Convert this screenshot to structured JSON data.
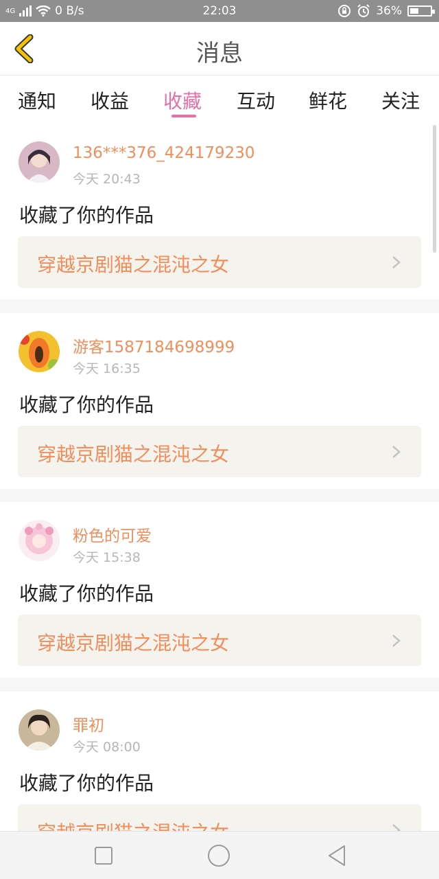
{
  "status_bar": {
    "network": "4G",
    "speed": "0 B/s",
    "time": "22:03",
    "battery": "36%"
  },
  "header": {
    "title": "消息"
  },
  "tabs": [
    {
      "label": "通知"
    },
    {
      "label": "收益"
    },
    {
      "label": "收藏"
    },
    {
      "label": "互动"
    },
    {
      "label": "鲜花"
    },
    {
      "label": "关注"
    }
  ],
  "active_tab_index": 2,
  "messages": [
    {
      "user": "136***376_424179230",
      "time": "今天 20:43",
      "action": "收藏了你的作品",
      "work": "穿越京剧猫之混沌之女"
    },
    {
      "user": "游客1587184698999",
      "time": "今天 16:35",
      "action": "收藏了你的作品",
      "work": "穿越京剧猫之混沌之女"
    },
    {
      "user": "粉色的可爱",
      "time": "今天 15:38",
      "action": "收藏了你的作品",
      "work": "穿越京剧猫之混沌之女"
    },
    {
      "user": "罪初",
      "time": "今天 08:00",
      "action": "收藏了你的作品",
      "work": "穿越京剧猫之混沌之女"
    }
  ],
  "colors": {
    "accent": "#e76fa5",
    "username": "#f08e5c",
    "back_icon": "#f5c400"
  },
  "icons": {
    "back": "chevron-left-icon",
    "nav_recents": "square-icon",
    "nav_home": "circle-icon",
    "nav_back": "triangle-back-icon"
  }
}
